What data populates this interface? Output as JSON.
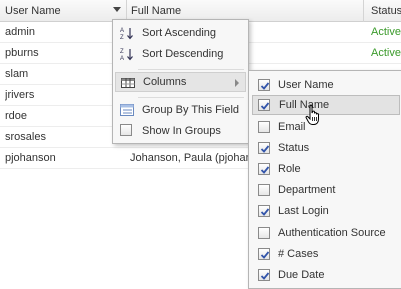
{
  "columns": {
    "user": "User Name",
    "full": "Full Name",
    "status": "Status"
  },
  "rows": [
    {
      "user": "admin",
      "full": "",
      "status": "Active"
    },
    {
      "user": "pburns",
      "full": "",
      "status": "Active"
    },
    {
      "user": "slam",
      "full": "",
      "status": ""
    },
    {
      "user": "jrivers",
      "full": "",
      "status": ""
    },
    {
      "user": "rdoe",
      "full": "",
      "status": ""
    },
    {
      "user": "srosales",
      "full": "",
      "status": ""
    },
    {
      "user": "pjohanson",
      "full": "Johanson, Paula (pjohanson)",
      "status": ""
    }
  ],
  "menu": {
    "sort_asc": "Sort Ascending",
    "sort_desc": "Sort Descending",
    "columns": "Columns",
    "group_by": "Group By This Field",
    "show_groups": "Show In Groups"
  },
  "column_options": [
    {
      "label": "User Name",
      "checked": true
    },
    {
      "label": "Full Name",
      "checked": true
    },
    {
      "label": "Email",
      "checked": false
    },
    {
      "label": "Status",
      "checked": true
    },
    {
      "label": "Role",
      "checked": true
    },
    {
      "label": "Department",
      "checked": false
    },
    {
      "label": "Last Login",
      "checked": true
    },
    {
      "label": "Authentication Source",
      "checked": false
    },
    {
      "label": "# Cases",
      "checked": true
    },
    {
      "label": "Due Date",
      "checked": true
    }
  ],
  "colors": {
    "status_active": "#3a9a2a",
    "checkmark": "#3355aa"
  }
}
